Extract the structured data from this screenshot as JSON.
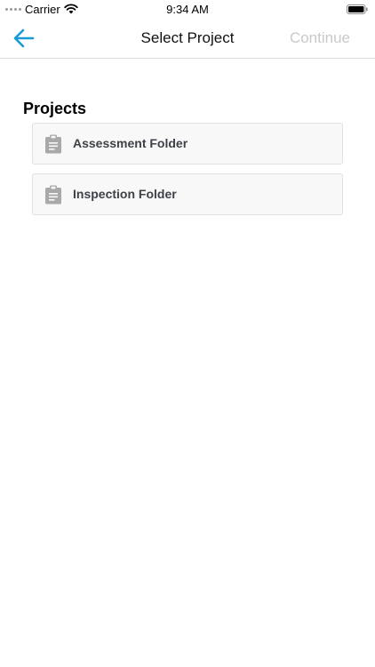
{
  "status_bar": {
    "carrier": "Carrier",
    "time": "9:34 AM",
    "icons": [
      "signal-dots-icon",
      "wifi-icon",
      "battery-icon"
    ]
  },
  "nav": {
    "back_icon": "arrow-left-icon",
    "title": "Select Project",
    "continue_label": "Continue",
    "continue_enabled": false
  },
  "main": {
    "section_title": "Projects",
    "projects": [
      {
        "label": "Assessment Folder",
        "icon": "clipboard-icon"
      },
      {
        "label": "Inspection Folder",
        "icon": "clipboard-icon"
      }
    ]
  },
  "colors": {
    "accent": "#1a9ad6",
    "disabled_text": "#c9c9c9",
    "item_background": "#f8f8f8",
    "item_border": "#e1e1e1",
    "icon_gray": "#a9a9a9",
    "item_text": "#3d4148"
  }
}
